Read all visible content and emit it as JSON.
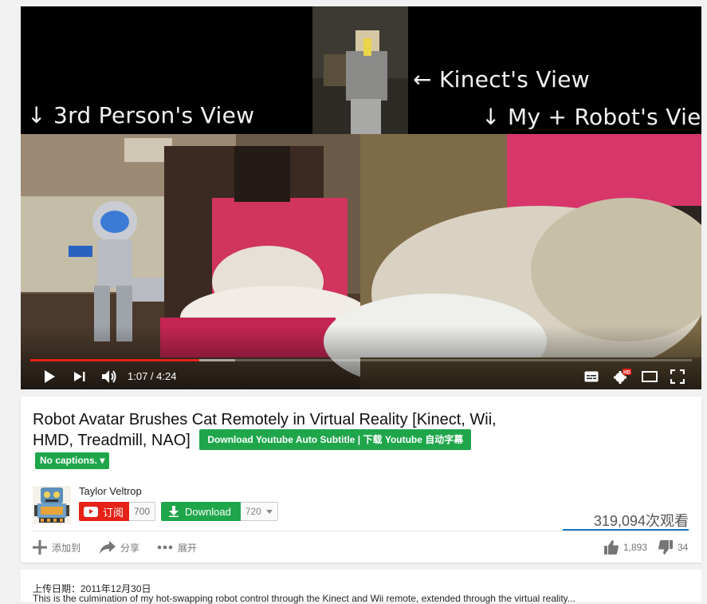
{
  "video": {
    "overlay_labels": {
      "third_person": "↓ 3rd Person's View",
      "kinect": "← Kinect's View",
      "robot": "↓ My + Robot's View"
    },
    "progress_fraction": 0.256,
    "buffered_fraction": 0.31,
    "time": "1:07 / 4:24",
    "hd_badge": "HD",
    "icons": [
      "play-icon",
      "next-icon",
      "volume-icon",
      "captions-icon",
      "settings-icon",
      "theater-icon",
      "fullscreen-icon"
    ]
  },
  "info": {
    "title": "Robot Avatar Brushes Cat Remotely in Virtual Reality [Kinect, Wii, HMD, Treadmill, NAO]",
    "download_subtitle_label": "Download Youtube Auto Subtitle | 下载 Youtube 自动字幕",
    "no_captions_label": "No captions. ▾",
    "channel_name": "Taylor Veltrop",
    "subscribe_label": "订阅",
    "subscriber_count": "700",
    "download_label": "Download",
    "download_quality": "720",
    "views": "319,094次观看",
    "actions": {
      "add_to": "添加到",
      "share": "分享",
      "more": "展开",
      "likes": "1,893",
      "dislikes": "34"
    },
    "colors": {
      "subscribe_red": "#e62117",
      "download_green": "#1fa64b",
      "progress_red": "#e52117",
      "views_bar_blue": "#167ac6"
    }
  },
  "description": {
    "upload_date": "上传日期：2011年12月30日",
    "text": "This is the culmination of my hot-swapping robot control through the Kinect and Wii remote, extended through the virtual reality..."
  }
}
